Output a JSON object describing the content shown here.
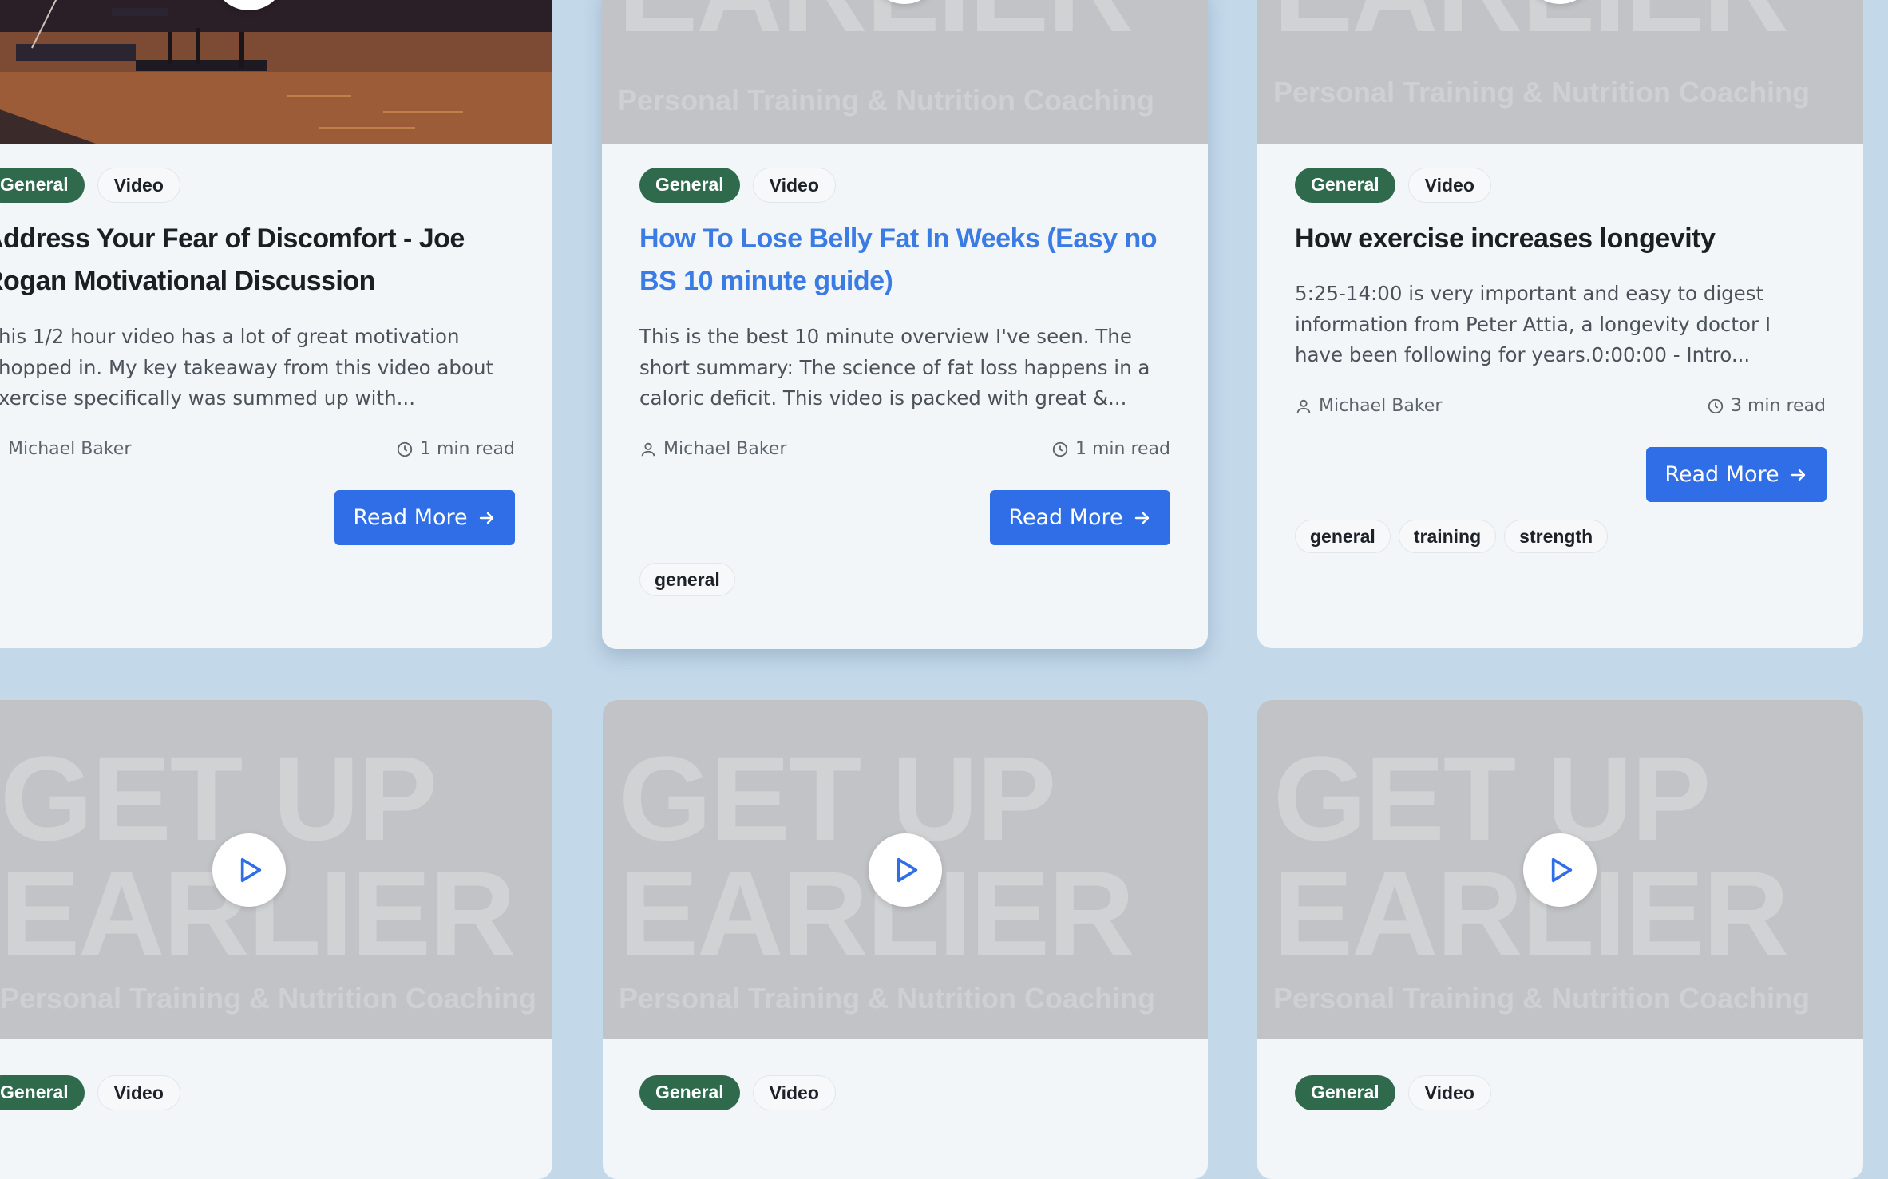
{
  "watermark": {
    "line1": "GET UP",
    "line2": "EARLIER",
    "line3": "Personal Training & Nutrition Coaching"
  },
  "cards": [
    {
      "category": "General",
      "type": "Video",
      "title_line1": "Address Your Fear of Discomfort - Joe",
      "title_line2": "Rogan Motivational Discussion",
      "excerpt_line1": "his 1/2 hour video has a lot of great motivation",
      "excerpt_line2": "hopped in. My key takeaway from this video about",
      "excerpt_line3": "xercise specifically was summed up with...",
      "author": "Michael Baker",
      "read_time": "1 min read",
      "button": "Read More"
    },
    {
      "category": "General",
      "type": "Video",
      "title_line1": "How To Lose Belly Fat In Weeks (Easy no",
      "title_line2": "BS 10 minute guide)",
      "excerpt_line1": "This is the best 10 minute overview I've seen. The",
      "excerpt_line2": "short summary: The science of fat loss happens in a",
      "excerpt_line3": "caloric deficit. This video is packed with great &...",
      "author": "Michael Baker",
      "read_time": "1 min read",
      "button": "Read More",
      "keywords": [
        "general"
      ]
    },
    {
      "category": "General",
      "type": "Video",
      "title_line1": "How exercise increases longevity",
      "excerpt_line1": "5:25-14:00 is very important and easy to digest",
      "excerpt_line2": "information from Peter Attia, a longevity doctor I",
      "excerpt_line3": "have been following for years.0:00:00 - Intro...",
      "author": "Michael Baker",
      "read_time": "3 min read",
      "button": "Read More",
      "keywords": [
        "general",
        "training",
        "strength"
      ]
    },
    {
      "category": "General",
      "type": "Video"
    },
    {
      "category": "General",
      "type": "Video"
    },
    {
      "category": "General",
      "type": "Video"
    }
  ]
}
